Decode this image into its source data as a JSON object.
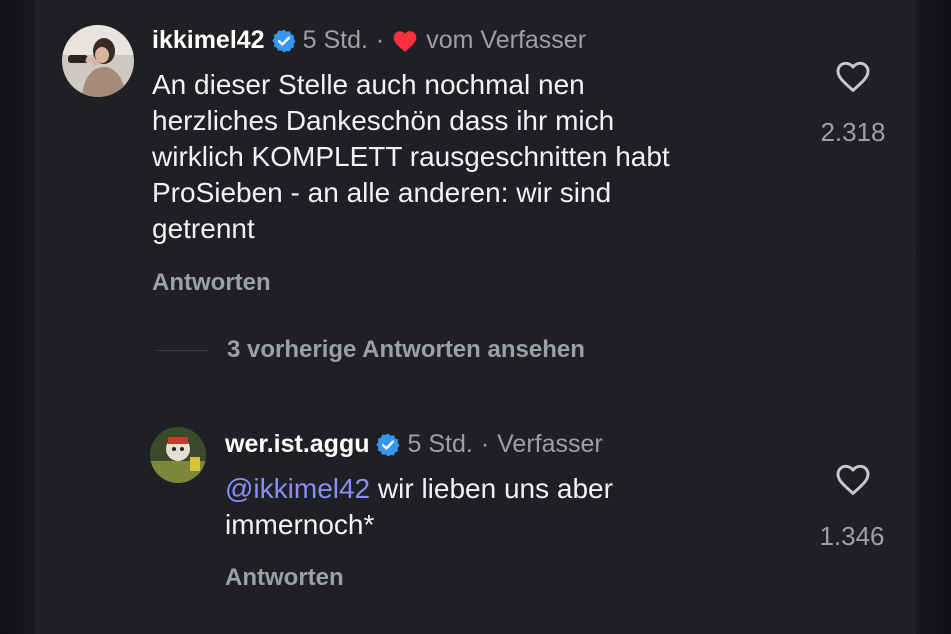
{
  "comments": [
    {
      "username": "ikkimel42",
      "time": "5 Std.",
      "separator": "·",
      "badge": "vom Verfasser",
      "lines": [
        "An dieser Stelle auch nochmal nen",
        "herzliches Dankeschön dass ihr mich",
        "wirklich KOMPLETT rausgeschnitten habt",
        "ProSieben - an alle anderen: wir sind",
        "getrennt"
      ],
      "reply_label": "Antworten",
      "like_count": "2.318"
    },
    {
      "username": "wer.ist.aggu",
      "time": "5 Std.",
      "separator": "·",
      "badge": "Verfasser",
      "mention": "@ikkimel42",
      "line1_rest": " wir lieben uns aber",
      "line2": "immernoch*",
      "reply_label": "Antworten",
      "like_count": "1.346"
    }
  ],
  "view_replies_label": "3 vorherige Antworten ansehen",
  "colors": {
    "background": "#1f2024",
    "text": "#f2f2f4",
    "muted": "#9d9fa6",
    "verified": "#3797f0",
    "heart": "#ff3040",
    "mention": "#8b8cf5"
  },
  "icons": [
    "verified-badge-icon",
    "heart-filled-icon",
    "heart-outline-icon"
  ]
}
